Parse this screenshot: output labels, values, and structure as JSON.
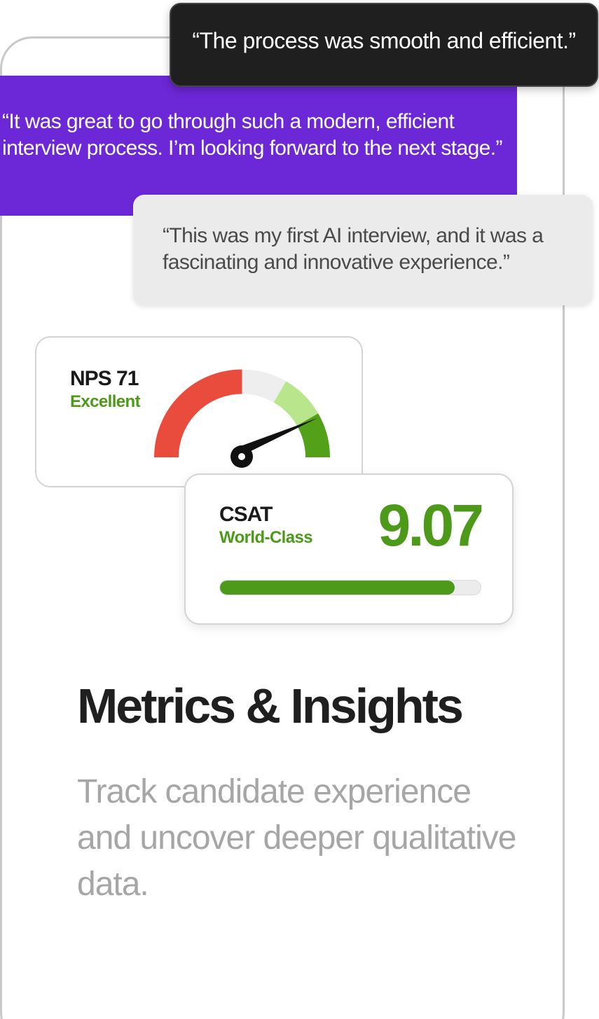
{
  "testimonials": {
    "dark": "“The process was smooth and efficient.”",
    "purple": "“It was great to go through such a modern, efficient interview process. I’m looking forward to the next stage.”",
    "gray": "“This was my first AI interview, and it was a fascinating and innovative experience.”"
  },
  "nps": {
    "label": "NPS 71",
    "rating": "Excellent",
    "colors": {
      "poor": "#e94b3c",
      "neutral": "#eeeeee",
      "good": "#b9e58c",
      "excellent": "#53a019",
      "needle": "#111111"
    }
  },
  "csat": {
    "label": "CSAT",
    "rating": "World-Class",
    "score": "9.07",
    "progress": 0.9,
    "colors": {
      "fill": "#4d9a1a",
      "track": "#ececec"
    }
  },
  "section": {
    "heading": "Metrics & Insights",
    "description": "Track candidate experience and uncover deeper qualitative data."
  },
  "colors": {
    "accent_purple": "#6c27d6",
    "accent_green": "#4d9a1a",
    "dark": "#1f1f1f"
  }
}
